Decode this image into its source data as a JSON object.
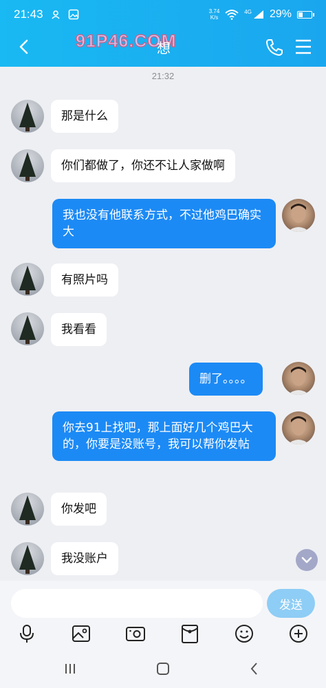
{
  "status_bar": {
    "time": "21:43",
    "net_speed_value": "3.74",
    "net_speed_unit": "K/s",
    "network": "4G",
    "battery": "29%",
    "battery_level": 0.29
  },
  "header": {
    "watermark": "91P46.COM",
    "chat_name": "想",
    "icons": [
      "back-arrow-icon",
      "phone-icon",
      "menu-icon"
    ]
  },
  "chat": {
    "timestamp": "21:32",
    "messages": [
      {
        "from": "other",
        "text": "那是什么"
      },
      {
        "from": "other",
        "text": "你们都做了，你还不让人家做啊"
      },
      {
        "from": "me",
        "text": "我也没有他联系方式，不过他鸡巴确实大"
      },
      {
        "from": "other",
        "text": "有照片吗"
      },
      {
        "from": "other",
        "text": "我看看"
      },
      {
        "from": "me",
        "text": "删了。。。。"
      },
      {
        "from": "me",
        "text": "你去91上找吧，那上面好几个鸡巴大的，你要是没账号，我可以帮你发帖"
      },
      {
        "from": "other",
        "text": "你发吧"
      },
      {
        "from": "other",
        "text": "我没账户"
      }
    ]
  },
  "input": {
    "value": "",
    "placeholder": "",
    "send_label": "发送"
  },
  "toolbar": {
    "icons": [
      "microphone-icon",
      "image-icon",
      "camera-icon",
      "red-packet-icon",
      "emoji-icon",
      "plus-icon"
    ]
  },
  "colors": {
    "header_start": "#19b9f3",
    "header_end": "#1aa6ee",
    "outgoing_bubble": "#1c8af5",
    "incoming_bubble": "#ffffff",
    "background": "#eeeff3"
  }
}
